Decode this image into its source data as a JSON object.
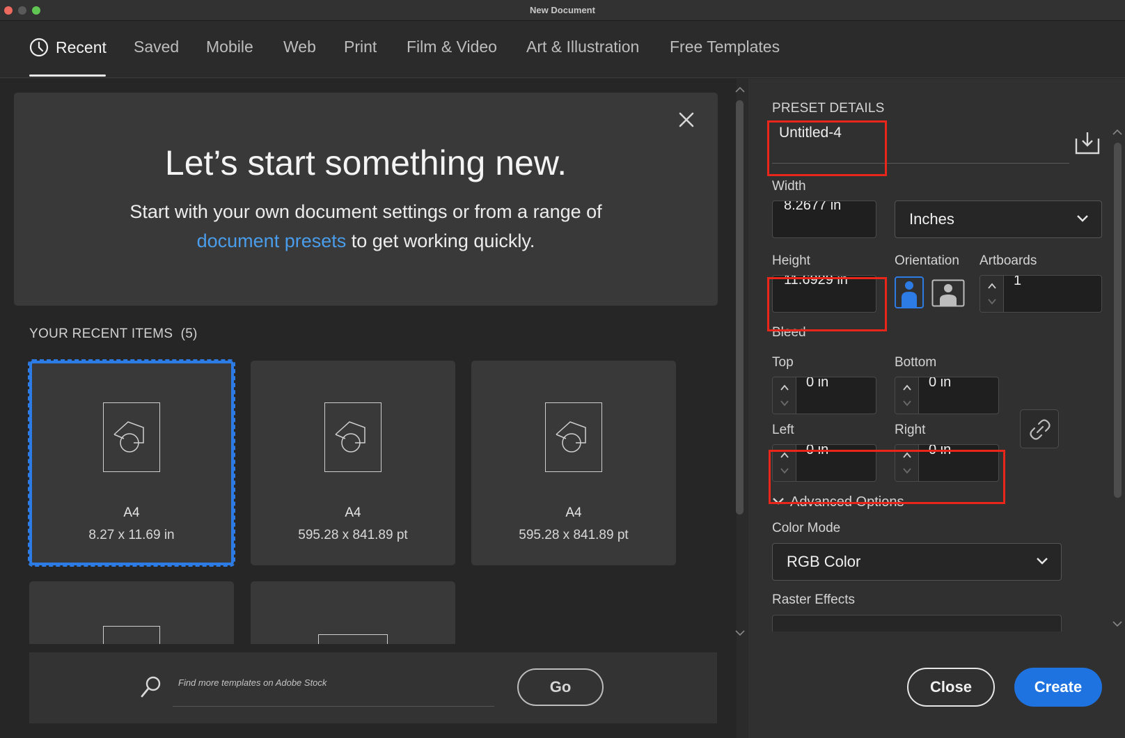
{
  "window": {
    "title": "New Document"
  },
  "tabs": [
    {
      "label": "Recent",
      "active": true
    },
    {
      "label": "Saved"
    },
    {
      "label": "Mobile"
    },
    {
      "label": "Web"
    },
    {
      "label": "Print"
    },
    {
      "label": "Film & Video"
    },
    {
      "label": "Art & Illustration"
    },
    {
      "label": "Free Templates"
    }
  ],
  "hero": {
    "title": "Let’s start something new.",
    "subtitle_line1": "Start with your own document settings or from a range of",
    "link": "document presets",
    "subtitle_line2_rest": " to get working quickly."
  },
  "recent": {
    "label": "YOUR RECENT ITEMS",
    "count": "(5)",
    "items": [
      {
        "name": "A4",
        "size": "8.27 x 11.69 in",
        "selected": true
      },
      {
        "name": "A4",
        "size": "595.28 x 841.89 pt"
      },
      {
        "name": "A4",
        "size": "595.28 x 841.89 pt"
      }
    ]
  },
  "search": {
    "placeholder": "Find more templates on Adobe Stock",
    "go_label": "Go"
  },
  "preset": {
    "section_label": "PRESET DETAILS",
    "name": "Untitled-4",
    "width_label": "Width",
    "width_value": "8.2677 in",
    "units": "Inches",
    "height_label": "Height",
    "height_value": "11.6929 in",
    "orientation_label": "Orientation",
    "artboards_label": "Artboards",
    "artboards_value": "1",
    "bleed_label": "Bleed",
    "top_label": "Top",
    "top_value": "0 in",
    "bottom_label": "Bottom",
    "bottom_value": "0 in",
    "left_label": "Left",
    "left_value": "0 in",
    "right_label": "Right",
    "right_value": "0 in",
    "advanced_label": "Advanced Options",
    "color_mode_label": "Color Mode",
    "color_mode_value": "RGB Color",
    "raster_label": "Raster Effects"
  },
  "actions": {
    "close_label": "Close",
    "create_label": "Create"
  },
  "colors": {
    "accent": "#1f73e0",
    "link": "#4a9dea",
    "highlight": "#e8271a",
    "selection": "#2d7ce6"
  }
}
